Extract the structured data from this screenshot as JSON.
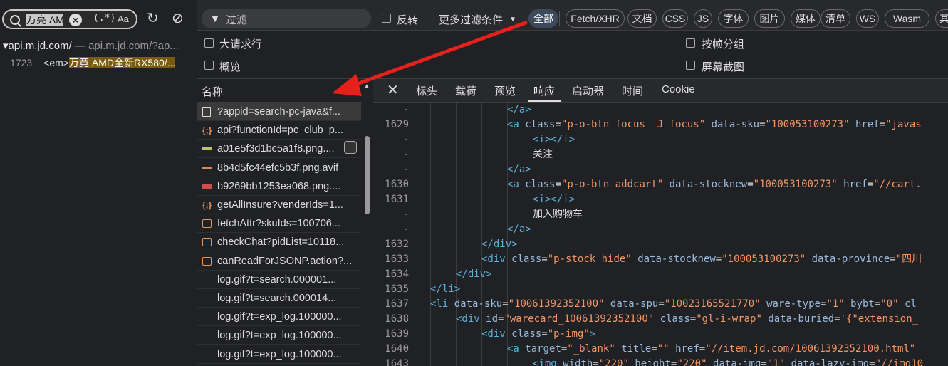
{
  "search": {
    "query": "万亮 AM",
    "regex_label": "(.*)",
    "case_label": "Aa",
    "result_host": "▾api.m.jd.com/",
    "result_url": " — api.m.jd.com/?ap...",
    "result_line_no": "1723",
    "result_prefix": "<em>",
    "result_highlight": "万竟 AMD全新RX580/..."
  },
  "toolbar": {
    "filter_placeholder": "过滤",
    "invert_label": "反转",
    "more_filters_label": "更多过滤条件",
    "chips": [
      "全部",
      "Fetch/XHR",
      "文档",
      "CSS",
      "JS",
      "字体",
      "图片",
      "媒体",
      "清单",
      "WS",
      "Wasm",
      "其他"
    ]
  },
  "options": {
    "big_rows": "大请求行",
    "overview": "概览",
    "group_by_frame": "按帧分组",
    "screenshots": "屏幕截图"
  },
  "list": {
    "header": "名称",
    "rows": [
      {
        "name": "?appid=search-pc-java&f...",
        "icon": "document-icon"
      },
      {
        "name": "api?functionId=pc_club_p...",
        "icon": "json-icon"
      },
      {
        "name": "a01e5f3d1bc5a1f8.png....",
        "icon": "image-icon"
      },
      {
        "name": "8b4d5fc44efc5b3f.png.avif",
        "icon": "image-icon"
      },
      {
        "name": "b9269bb1253ea068.png....",
        "icon": "image-icon"
      },
      {
        "name": "getAllInsure?venderIds=1...",
        "icon": "json-icon"
      },
      {
        "name": "fetchAttr?skuIds=100706...",
        "icon": "script-icon"
      },
      {
        "name": "checkChat?pidList=10118...",
        "icon": "script-icon"
      },
      {
        "name": "canReadForJSONP.action?...",
        "icon": "script-icon"
      },
      {
        "name": "log.gif?t=search.000001...",
        "icon": ""
      },
      {
        "name": "log.gif?t=search.000014...",
        "icon": ""
      },
      {
        "name": "log.gif?t=exp_log.100000...",
        "icon": ""
      },
      {
        "name": "log.gif?t=exp_log.100000...",
        "icon": ""
      },
      {
        "name": "log.gif?t=exp_log.100000...",
        "icon": ""
      }
    ]
  },
  "detail": {
    "tabs": [
      "标头",
      "载荷",
      "预览",
      "响应",
      "启动器",
      "时间",
      "Cookie"
    ],
    "active_tab": "响应",
    "lines": [
      {
        "n": "-",
        "indent": 6,
        "parts": [
          [
            "tag",
            "</a>"
          ]
        ]
      },
      {
        "n": "1629",
        "indent": 6,
        "parts": [
          [
            "tag",
            "<a "
          ],
          [
            "attr",
            "class"
          ],
          [
            "txt",
            "="
          ],
          [
            "val",
            "\"p-o-btn focus  J_focus\""
          ],
          [
            "txt",
            " "
          ],
          [
            "attr",
            "data-sku"
          ],
          [
            "txt",
            "="
          ],
          [
            "val",
            "\"100053100273\""
          ],
          [
            "txt",
            " "
          ],
          [
            "attr",
            "href"
          ],
          [
            "txt",
            "="
          ],
          [
            "val",
            "\"javas"
          ]
        ]
      },
      {
        "n": "-",
        "indent": 7,
        "parts": [
          [
            "tag",
            "<i></i>"
          ]
        ]
      },
      {
        "n": "-",
        "indent": 7,
        "parts": [
          [
            "txt",
            "关注"
          ]
        ]
      },
      {
        "n": "-",
        "indent": 6,
        "parts": [
          [
            "tag",
            "</a>"
          ]
        ]
      },
      {
        "n": "1630",
        "indent": 6,
        "parts": [
          [
            "tag",
            "<a "
          ],
          [
            "attr",
            "class"
          ],
          [
            "txt",
            "="
          ],
          [
            "val",
            "\"p-o-btn addcart\""
          ],
          [
            "txt",
            " "
          ],
          [
            "attr",
            "data-stocknew"
          ],
          [
            "txt",
            "="
          ],
          [
            "val",
            "\"100053100273\""
          ],
          [
            "txt",
            " "
          ],
          [
            "attr",
            "href"
          ],
          [
            "txt",
            "="
          ],
          [
            "val",
            "\"//cart."
          ]
        ]
      },
      {
        "n": "1631",
        "indent": 7,
        "parts": [
          [
            "tag",
            "<i></i>"
          ]
        ]
      },
      {
        "n": "-",
        "indent": 7,
        "parts": [
          [
            "txt",
            "加入购物车"
          ]
        ]
      },
      {
        "n": "-",
        "indent": 6,
        "parts": [
          [
            "tag",
            "</a>"
          ]
        ]
      },
      {
        "n": "1632",
        "indent": 5,
        "parts": [
          [
            "tag",
            "</div>"
          ]
        ]
      },
      {
        "n": "1633",
        "indent": 5,
        "parts": [
          [
            "tag",
            "<div "
          ],
          [
            "attr",
            "class"
          ],
          [
            "txt",
            "="
          ],
          [
            "val",
            "\"p-stock hide\""
          ],
          [
            "txt",
            " "
          ],
          [
            "attr",
            "data-stocknew"
          ],
          [
            "txt",
            "="
          ],
          [
            "val",
            "\"100053100273\""
          ],
          [
            "txt",
            " "
          ],
          [
            "attr",
            "data-province"
          ],
          [
            "txt",
            "="
          ],
          [
            "val",
            "\"四川"
          ]
        ]
      },
      {
        "n": "1634",
        "indent": 4,
        "parts": [
          [
            "tag",
            "</div>"
          ]
        ]
      },
      {
        "n": "1635",
        "indent": 3,
        "parts": [
          [
            "tag",
            "</li>"
          ]
        ]
      },
      {
        "n": "1637",
        "indent": 3,
        "parts": [
          [
            "tag",
            "<li "
          ],
          [
            "attr",
            "data-sku"
          ],
          [
            "txt",
            "="
          ],
          [
            "val",
            "\"10061392352100\""
          ],
          [
            "txt",
            " "
          ],
          [
            "attr",
            "data-spu"
          ],
          [
            "txt",
            "="
          ],
          [
            "val",
            "\"10023165521770\""
          ],
          [
            "txt",
            " "
          ],
          [
            "attr",
            "ware-type"
          ],
          [
            "txt",
            "="
          ],
          [
            "val",
            "\"1\""
          ],
          [
            "txt",
            " "
          ],
          [
            "attr",
            "bybt"
          ],
          [
            "txt",
            "="
          ],
          [
            "val",
            "\"0\""
          ],
          [
            "txt",
            " "
          ],
          [
            "attr",
            "cl"
          ]
        ]
      },
      {
        "n": "1638",
        "indent": 4,
        "parts": [
          [
            "tag",
            "<div "
          ],
          [
            "attr",
            "id"
          ],
          [
            "txt",
            "="
          ],
          [
            "val",
            "\"warecard_10061392352100\""
          ],
          [
            "txt",
            " "
          ],
          [
            "attr",
            "class"
          ],
          [
            "txt",
            "="
          ],
          [
            "val",
            "\"gl-i-wrap\""
          ],
          [
            "txt",
            " "
          ],
          [
            "attr",
            "data-buried"
          ],
          [
            "txt",
            "="
          ],
          [
            "val",
            "'{\"extension_"
          ]
        ]
      },
      {
        "n": "1639",
        "indent": 5,
        "parts": [
          [
            "tag",
            "<div "
          ],
          [
            "attr",
            "class"
          ],
          [
            "txt",
            "="
          ],
          [
            "val",
            "\"p-img\""
          ],
          [
            "tag",
            ">"
          ]
        ]
      },
      {
        "n": "1640",
        "indent": 6,
        "parts": [
          [
            "tag",
            "<a "
          ],
          [
            "attr",
            "target"
          ],
          [
            "txt",
            "="
          ],
          [
            "val",
            "\"_blank\""
          ],
          [
            "txt",
            " "
          ],
          [
            "attr",
            "title"
          ],
          [
            "txt",
            "="
          ],
          [
            "val",
            "\"\""
          ],
          [
            "txt",
            " "
          ],
          [
            "attr",
            "href"
          ],
          [
            "txt",
            "="
          ],
          [
            "val",
            "\"//item.jd.com/10061392352100.html\""
          ],
          [
            "txt",
            " "
          ]
        ]
      },
      {
        "n": "1643",
        "indent": 7,
        "parts": [
          [
            "tag",
            "<img "
          ],
          [
            "attr",
            "width"
          ],
          [
            "txt",
            "="
          ],
          [
            "val",
            "\"220\""
          ],
          [
            "txt",
            " "
          ],
          [
            "attr",
            "height"
          ],
          [
            "txt",
            "="
          ],
          [
            "val",
            "\"220\""
          ],
          [
            "txt",
            " "
          ],
          [
            "attr",
            "data-img"
          ],
          [
            "txt",
            "="
          ],
          [
            "val",
            "\"1\""
          ],
          [
            "txt",
            " "
          ],
          [
            "attr",
            "data-lazy-img"
          ],
          [
            "txt",
            "="
          ],
          [
            "val",
            "\"//img10"
          ]
        ]
      }
    ]
  },
  "colors": {
    "arrow": "#e8201c",
    "highlight": "#7a5a10"
  }
}
